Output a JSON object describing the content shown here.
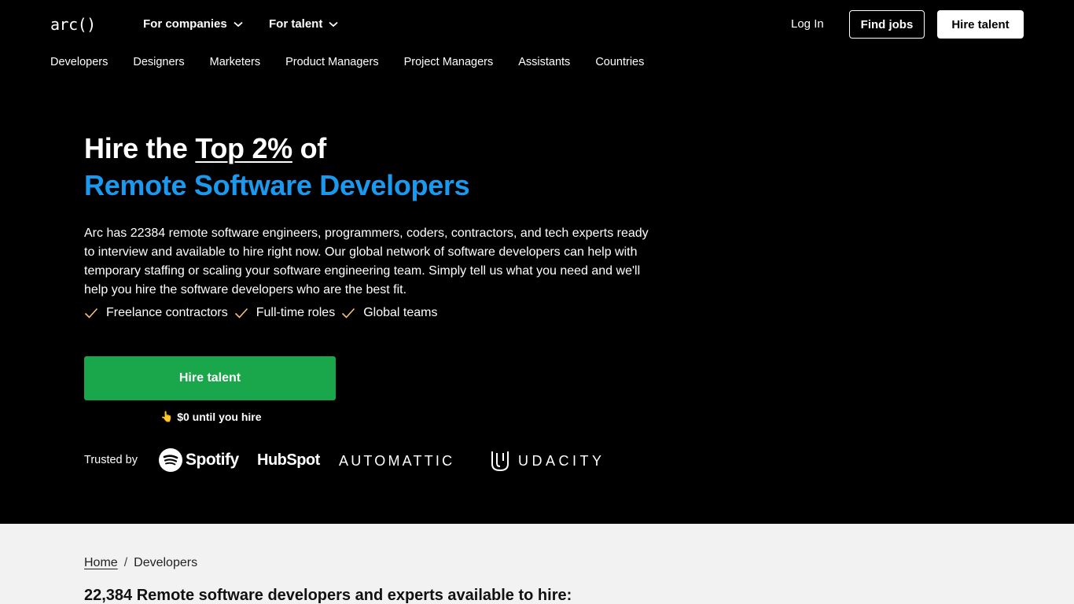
{
  "header": {
    "logo": "arc()",
    "nav": [
      {
        "label": "For companies"
      },
      {
        "label": "For talent"
      }
    ],
    "login": "Log In",
    "find_jobs": "Find jobs",
    "hire_talent": "Hire talent"
  },
  "subnav": [
    "Developers",
    "Designers",
    "Marketers",
    "Product Managers",
    "Project Managers",
    "Assistants",
    "Countries"
  ],
  "hero": {
    "title_prefix": "Hire the",
    "title_highlight": "Top 2%",
    "title_suffix": "of",
    "title_line2": "Remote Software Developers",
    "description": "Arc has 22384 remote software engineers, programmers, coders, contractors, and tech experts ready to interview and available to hire right now. Our global network of software developers can help with temporary staffing or scaling your software engineering team. Simply tell us what you need and we'll help you hire the software developers who are the best fit.",
    "checks": [
      "Freelance contractors",
      "Full-time roles",
      "Global teams"
    ],
    "cta": "Hire talent",
    "cta_note": "$0 until you hire",
    "trusted_by": "Trusted by",
    "logos": {
      "spotify": "Spotify",
      "hubspot": "HubSpot",
      "automattic": "AUTOMATTIC",
      "udacity": "UDACITY"
    }
  },
  "breadcrumb": {
    "home": "Home",
    "separator": "/",
    "current": "Developers"
  },
  "section_title": "22,384 Remote software developers and experts available to hire:",
  "colors": {
    "accent_blue": "#1a9aef",
    "cta_green": "#1aa64a",
    "hero_bg": "#000000",
    "lower_bg": "#f2f2f2"
  }
}
